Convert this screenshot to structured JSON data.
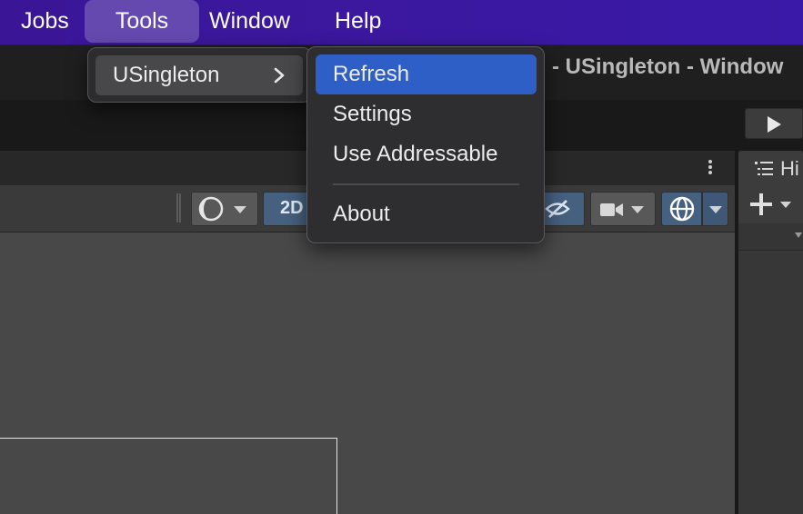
{
  "menubar": {
    "items": [
      {
        "label": "Jobs"
      },
      {
        "label": "Tools"
      },
      {
        "label": "Window"
      },
      {
        "label": "Help"
      }
    ]
  },
  "window": {
    "title": "- USingleton - Window"
  },
  "tools_menu": {
    "items": [
      {
        "label": "USingleton",
        "icon": "chevron-right-icon"
      }
    ]
  },
  "usingleton_submenu": {
    "items": [
      {
        "label": "Refresh",
        "highlighted": true
      },
      {
        "label": "Settings",
        "highlighted": false
      },
      {
        "label": "Use Addressable",
        "highlighted": false
      },
      {
        "label": "About",
        "highlighted": false
      }
    ]
  },
  "scene_toolbar": {
    "mode_2d": "2D"
  },
  "hierarchy": {
    "tab_label": "Hi"
  },
  "colors": {
    "menubar": "#3b18a0",
    "highlight": "#2e5fc6",
    "scene_bg": "#484848",
    "toggle_blue": "#46607f"
  }
}
